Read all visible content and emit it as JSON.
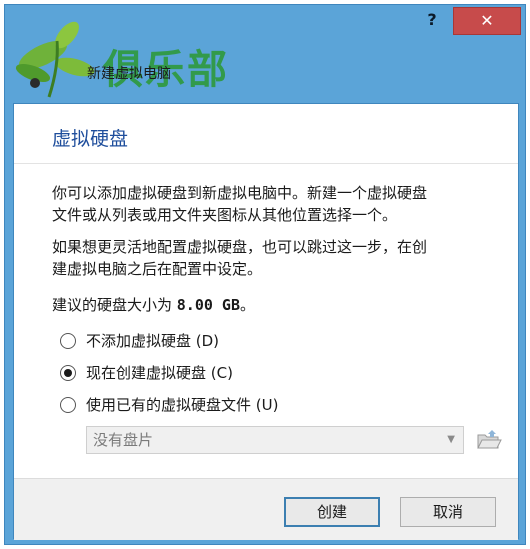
{
  "window": {
    "title": "新建虚拟电脑",
    "watermark": "俱乐部",
    "help": "?",
    "close": "✕"
  },
  "page": {
    "heading": "虚拟硬盘",
    "para1_line1": "你可以添加虚拟硬盘到新虚拟电脑中。新建一个虚拟硬盘",
    "para1_line2": "文件或从列表或用文件夹图标从其他位置选择一个。",
    "para2_line1": "如果想更灵活地配置虚拟硬盘，也可以跳过这一步，在创",
    "para2_line2": "建虚拟电脑之后在配置中设定。",
    "recommended_prefix": "建议的硬盘大小为 ",
    "recommended_size": "8.00 GB",
    "recommended_suffix": "。"
  },
  "options": [
    {
      "label": "不添加虚拟硬盘 (D)",
      "selected": false
    },
    {
      "label": "现在创建虚拟硬盘 (C)",
      "selected": true
    },
    {
      "label": "使用已有的虚拟硬盘文件 (U)",
      "selected": false
    }
  ],
  "disk_select": {
    "value": "没有盘片"
  },
  "buttons": {
    "create": "创建",
    "cancel": "取消"
  },
  "icons": {
    "folder": "folder-open-icon",
    "dropdown": "chevron-down-icon"
  }
}
